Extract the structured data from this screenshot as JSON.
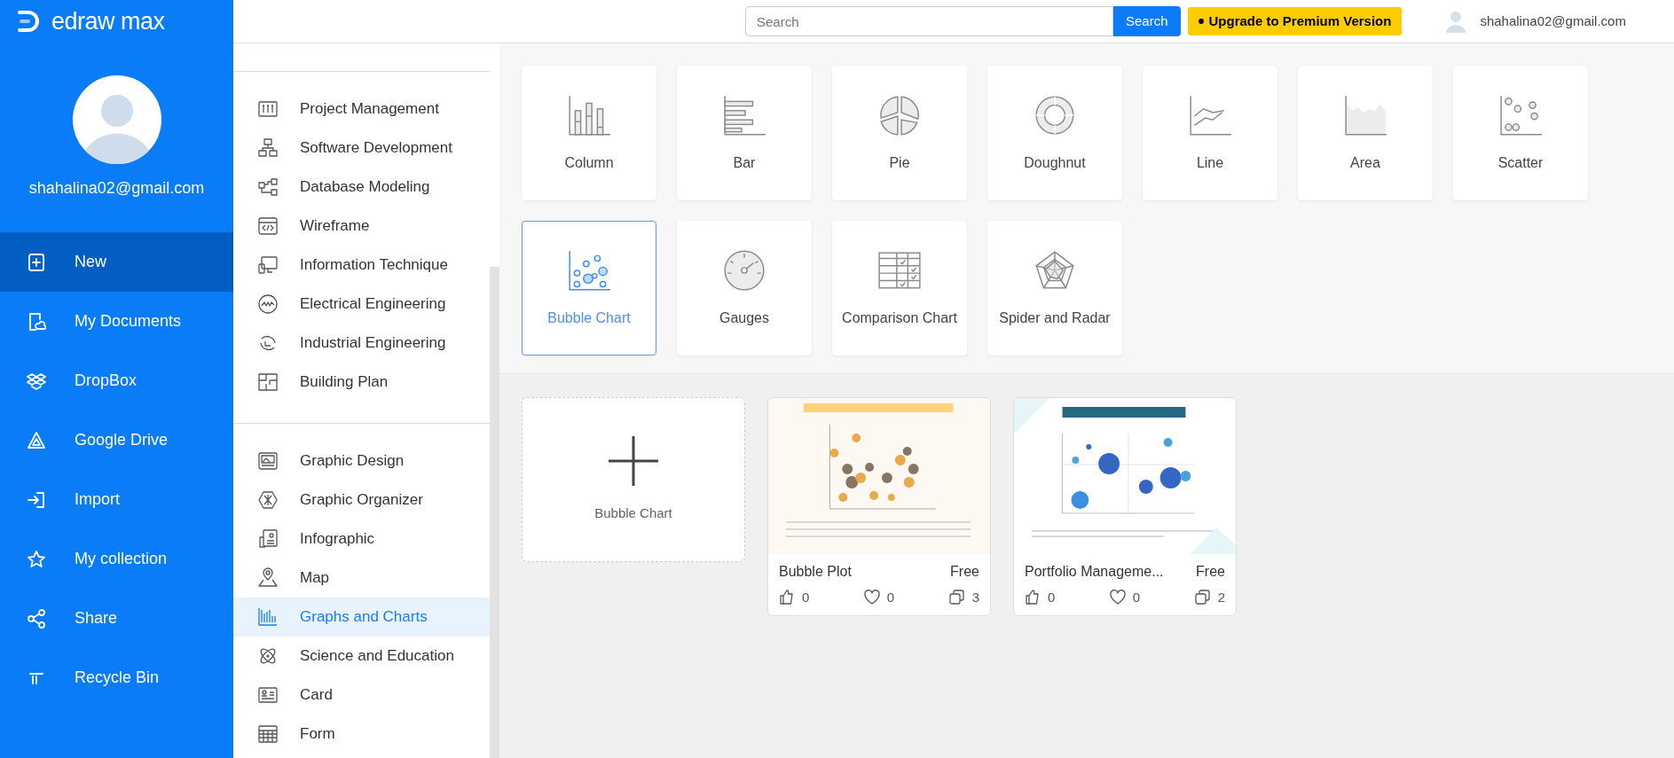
{
  "app": {
    "logo_text": "edraw max"
  },
  "user": {
    "email": "shahalina02@gmail.com"
  },
  "nav": [
    {
      "label": "New",
      "kind": "new",
      "selected": true
    },
    {
      "label": "My Documents",
      "kind": "docs",
      "selected": false
    },
    {
      "label": "DropBox",
      "kind": "dropbox",
      "selected": false
    },
    {
      "label": "Google Drive",
      "kind": "drive",
      "selected": false
    },
    {
      "label": "Import",
      "kind": "import",
      "selected": false
    },
    {
      "label": "My collection",
      "kind": "star",
      "selected": false
    },
    {
      "label": "Share",
      "kind": "share",
      "selected": false
    },
    {
      "label": "Recycle Bin",
      "kind": "bin",
      "selected": false
    }
  ],
  "topbar": {
    "search": {
      "placeholder": "Search",
      "button": "Search"
    },
    "upgrade": "Upgrade to Premium Version",
    "email": "shahalina02@gmail.com"
  },
  "categories": [
    [
      {
        "label": "Project Management",
        "kind": "board",
        "selected": false
      },
      {
        "label": "Software Development",
        "kind": "tree",
        "selected": false
      },
      {
        "label": "Database Modeling",
        "kind": "db",
        "selected": false
      },
      {
        "label": "Wireframe",
        "kind": "code",
        "selected": false
      },
      {
        "label": "Information Technique",
        "kind": "devices",
        "selected": false
      },
      {
        "label": "Electrical Engineering",
        "kind": "wave",
        "selected": false
      },
      {
        "label": "Industrial Engineering",
        "kind": "cycle",
        "selected": false
      },
      {
        "label": "Building Plan",
        "kind": "plan",
        "selected": false
      }
    ],
    [
      {
        "label": "Graphic Design",
        "kind": "image",
        "selected": false
      },
      {
        "label": "Graphic Organizer",
        "kind": "hex",
        "selected": false
      },
      {
        "label": "Infographic",
        "kind": "info",
        "selected": false
      },
      {
        "label": "Map",
        "kind": "pin",
        "selected": false
      },
      {
        "label": "Graphs and Charts",
        "kind": "bars",
        "selected": true
      },
      {
        "label": "Science and Education",
        "kind": "atom",
        "selected": false
      },
      {
        "label": "Card",
        "kind": "card",
        "selected": false
      },
      {
        "label": "Form",
        "kind": "grid",
        "selected": false
      }
    ]
  ],
  "chart_types": [
    {
      "label": "Column",
      "kind": "column",
      "selected": false
    },
    {
      "label": "Bar",
      "kind": "bar",
      "selected": false
    },
    {
      "label": "Pie",
      "kind": "pie",
      "selected": false
    },
    {
      "label": "Doughnut",
      "kind": "doughnut",
      "selected": false
    },
    {
      "label": "Line",
      "kind": "line",
      "selected": false
    },
    {
      "label": "Area",
      "kind": "area",
      "selected": false
    },
    {
      "label": "Scatter",
      "kind": "scatter",
      "selected": false
    },
    {
      "label": "Bubble Chart",
      "kind": "bubble",
      "selected": true
    },
    {
      "label": "Gauges",
      "kind": "gauge",
      "selected": false
    },
    {
      "label": "Comparison Chart",
      "kind": "comparison",
      "selected": false
    },
    {
      "label": "Spider and Radar",
      "kind": "radar",
      "selected": false
    }
  ],
  "new_blank": {
    "label": "Bubble Chart"
  },
  "templates": [
    {
      "title": "Bubble Plot",
      "price": "Free",
      "likes": "0",
      "favorites": "0",
      "copies": "3",
      "kind": "warm"
    },
    {
      "title": "Portfolio Manageme...",
      "price": "Free",
      "likes": "0",
      "favorites": "0",
      "copies": "2",
      "kind": "cool"
    }
  ]
}
